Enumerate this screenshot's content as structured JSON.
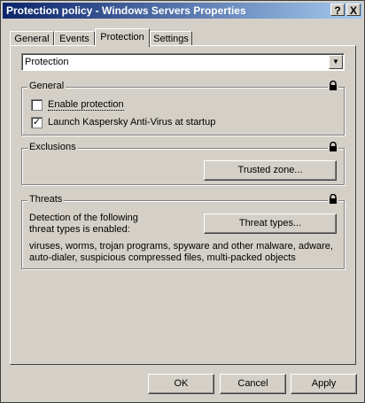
{
  "window": {
    "title": "Protection policy - Windows Servers Properties"
  },
  "titlebar_buttons": {
    "help": "?",
    "close": "X"
  },
  "tabs": [
    {
      "label": "General"
    },
    {
      "label": "Events"
    },
    {
      "label": "Protection"
    },
    {
      "label": "Settings"
    }
  ],
  "combo": {
    "value": "Protection"
  },
  "general_group": {
    "title": "General",
    "enable_protection": {
      "label": "Enable protection",
      "checked": false
    },
    "launch_av": {
      "label": "Launch Kaspersky Anti-Virus at startup",
      "checked": true
    }
  },
  "exclusions_group": {
    "title": "Exclusions",
    "trusted_zone_button": "Trusted zone..."
  },
  "threats_group": {
    "title": "Threats",
    "description_line1": "Detection of the following",
    "description_line2": "threat types is enabled:",
    "threat_types_button": "Threat types...",
    "list_line1": "viruses, worms, trojan programs, spyware and other malware, adware,",
    "list_line2": "auto-dialer, suspicious compressed files, multi-packed objects"
  },
  "footer": {
    "ok": "OK",
    "cancel": "Cancel",
    "apply": "Apply"
  }
}
